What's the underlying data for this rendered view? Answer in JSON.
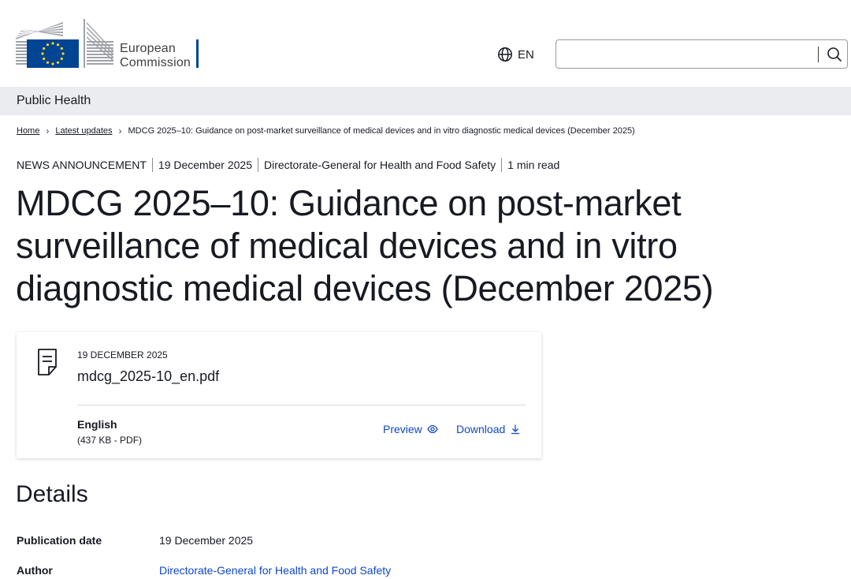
{
  "header": {
    "logo_line1": "European",
    "logo_line2": "Commission",
    "language": "EN",
    "search": {
      "value": "",
      "placeholder": ""
    }
  },
  "site_name": "Public Health",
  "breadcrumb": [
    "Home",
    "Latest updates",
    "MDCG 2025–10: Guidance on post-market surveillance of medical devices and in vitro diagnostic medical devices (December 2025)"
  ],
  "meta": {
    "type": "NEWS ANNOUNCEMENT",
    "date": "19 December 2025",
    "department": "Directorate-General for Health and Food Safety",
    "read_time": "1 min read"
  },
  "title": "MDCG 2025–10: Guidance on post-market surveillance of medical devices and in vitro diagnostic medical devices (December 2025)",
  "file": {
    "date": "19 DECEMBER 2025",
    "name": "mdcg_2025-10_en.pdf",
    "language": "English",
    "size": "(437 KB - PDF)",
    "preview_label": "Preview",
    "download_label": "Download"
  },
  "details": {
    "heading": "Details",
    "rows": [
      {
        "label": "Publication date",
        "value": "19 December 2025"
      },
      {
        "label": "Author",
        "value": "Directorate-General for Health and Food Safety"
      }
    ]
  },
  "colors": {
    "eu_blue": "#004494",
    "eu_yellow": "#ffd617",
    "link": "#0e47cb",
    "site_bar": "#ebecef"
  },
  "icons": [
    "eu-flag-icon",
    "globe-icon",
    "search-icon",
    "file-icon",
    "eye-icon",
    "download-icon",
    "chevron-right-icon"
  ]
}
